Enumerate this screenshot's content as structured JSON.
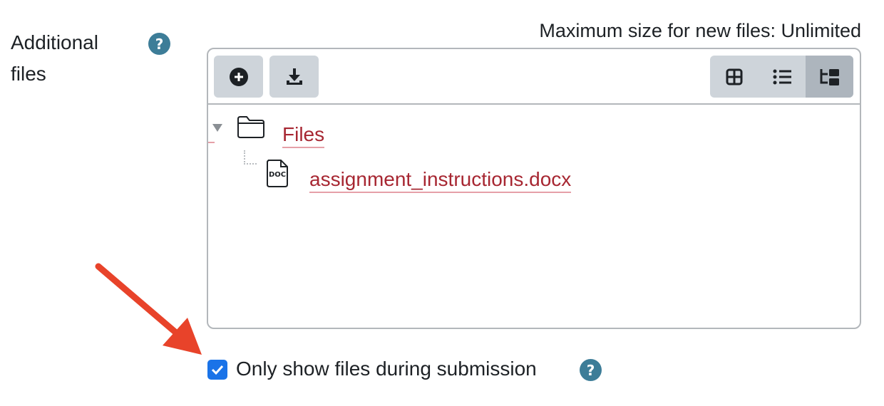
{
  "field": {
    "label": "Additional files",
    "help_icon": "question-mark-icon",
    "max_size_text": "Maximum size for new files: Unlimited"
  },
  "toolbar": {
    "add_icon": "plus-circle-icon",
    "download_icon": "download-icon",
    "views": [
      {
        "icon": "grid-view-icon",
        "active": false
      },
      {
        "icon": "list-view-icon",
        "active": false
      },
      {
        "icon": "tree-view-icon",
        "active": true
      }
    ]
  },
  "tree": {
    "folder": {
      "name": "Files",
      "icon": "folder-icon",
      "expanded": true
    },
    "files": [
      {
        "name": "assignment_instructions.docx",
        "icon": "doc-file-icon",
        "badge": "DOC"
      }
    ]
  },
  "option": {
    "checked": true,
    "label": "Only show files during submission",
    "help_icon": "question-mark-icon"
  },
  "colors": {
    "link": "#a72732",
    "help": "#3d7d98",
    "checkbox": "#1a73e8",
    "annotation_arrow": "#e8432a"
  }
}
